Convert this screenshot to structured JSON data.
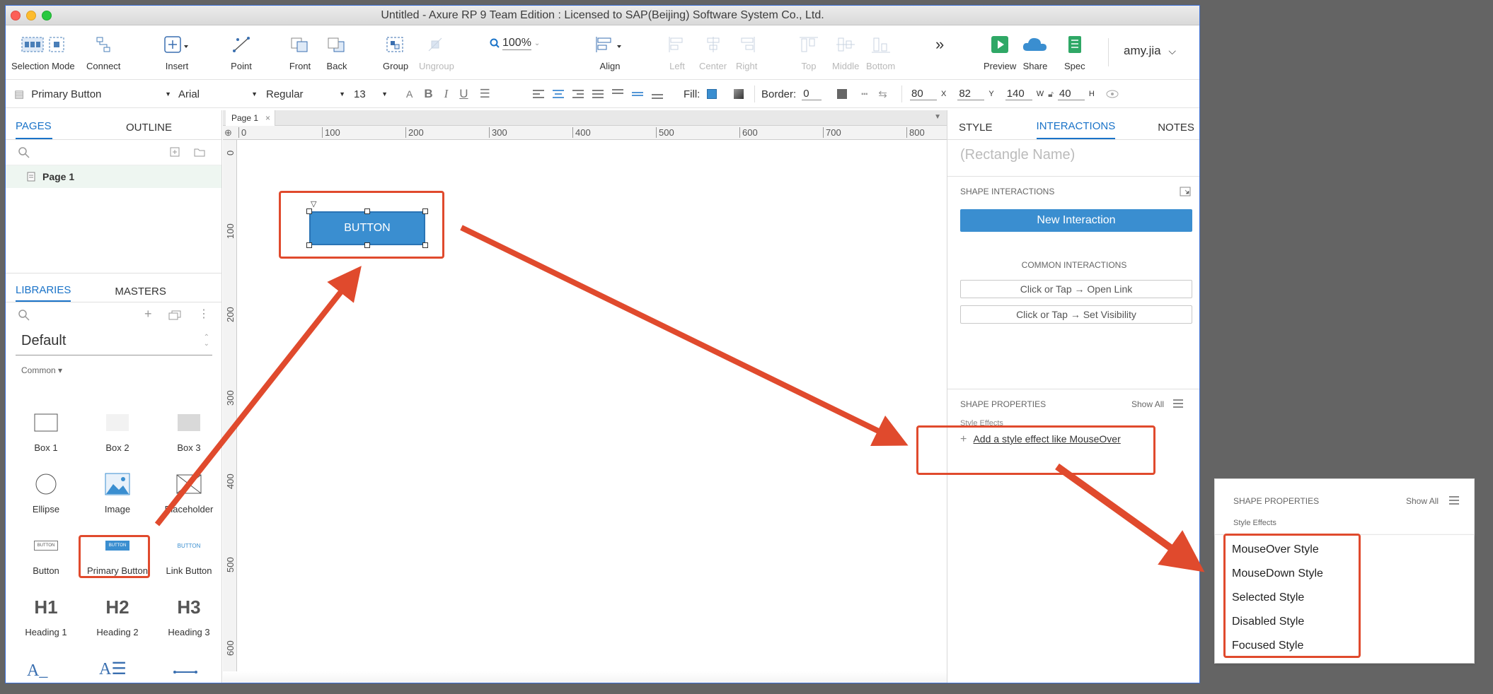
{
  "window": {
    "title": "Untitled - Axure RP 9 Team Edition : Licensed to SAP(Beijing) Software System Co., Ltd."
  },
  "toolbar": {
    "selection_mode": "Selection Mode",
    "connect": "Connect",
    "insert": "Insert",
    "point": "Point",
    "front": "Front",
    "back": "Back",
    "group": "Group",
    "ungroup": "Ungroup",
    "zoom": "100%",
    "align": "Align",
    "left": "Left",
    "center": "Center",
    "right": "Right",
    "top": "Top",
    "middle": "Middle",
    "bottom": "Bottom",
    "more": "»",
    "preview": "Preview",
    "share": "Share",
    "spec": "Spec",
    "user": "amy.jia"
  },
  "format": {
    "style_name": "Primary Button",
    "font": "Arial",
    "weight": "Regular",
    "size": "13",
    "fill_label": "Fill:",
    "border_label": "Border:",
    "border_value": "0",
    "x": "80",
    "x_label": "X",
    "y": "82",
    "y_label": "Y",
    "w": "140",
    "w_label": "W",
    "h": "40",
    "h_label": "H"
  },
  "left": {
    "tabs": [
      "PAGES",
      "OUTLINE"
    ],
    "page": "Page 1",
    "lib_tabs": [
      "LIBRARIES",
      "MASTERS"
    ],
    "library": "Default",
    "category": "Common ▾",
    "widgets": [
      "Box 1",
      "Box 2",
      "Box 3",
      "Ellipse",
      "Image",
      "Placeholder",
      "Button",
      "Primary Button",
      "Link Button",
      "Heading 1",
      "Heading 2",
      "Heading 3"
    ],
    "heading_glyphs": [
      "H1",
      "H2",
      "H3"
    ],
    "button_glyph": "BUTTON"
  },
  "canvas": {
    "tab": "Page 1",
    "ruler_top": [
      "0",
      "100",
      "200",
      "300",
      "400",
      "500",
      "600",
      "700",
      "800"
    ],
    "ruler_left": [
      "0",
      "100",
      "200",
      "300",
      "400",
      "500",
      "600"
    ],
    "button_text": "BUTTON"
  },
  "right": {
    "tabs": [
      "STYLE",
      "INTERACTIONS",
      "NOTES"
    ],
    "name_placeholder": "(Rectangle Name)",
    "shape_interactions": "SHAPE INTERACTIONS",
    "new_interaction": "New Interaction",
    "common_interactions": "COMMON INTERACTIONS",
    "common": [
      "Click or Tap → Open Link",
      "Click or Tap → Set Visibility"
    ],
    "shape_properties": "SHAPE PROPERTIES",
    "show_all": "Show All",
    "style_effects": "Style Effects",
    "add_effect": "Add a style effect like MouseOver"
  },
  "callout": {
    "shape_properties": "SHAPE PROPERTIES",
    "show_all": "Show All",
    "style_effects": "Style Effects",
    "items": [
      "MouseOver Style",
      "MouseDown Style",
      "Selected Style",
      "Disabled Style",
      "Focused Style"
    ]
  },
  "colors": {
    "accent": "#1a73c8",
    "button": "#3a8ed0",
    "annotation": "#e04a2d"
  }
}
